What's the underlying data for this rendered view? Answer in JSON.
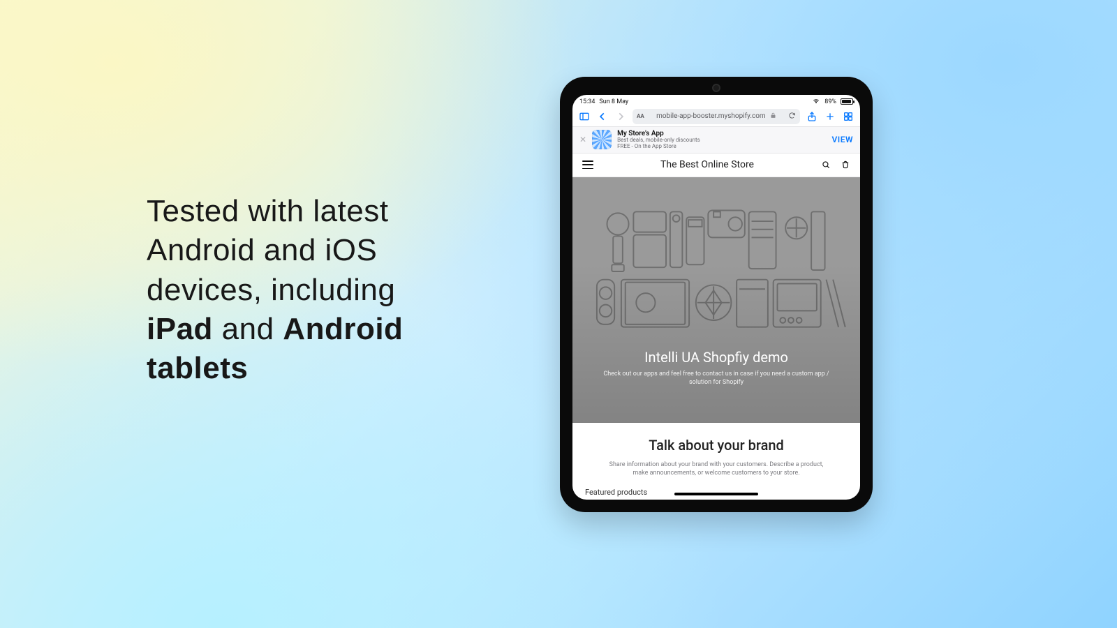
{
  "headline": {
    "line1": "Tested with latest",
    "line2": "Android and iOS",
    "line3": "devices, including",
    "bold1": "iPad",
    "mid": " and ",
    "bold2": "Android",
    "line5": "tablets"
  },
  "status": {
    "time": "15:34",
    "date": "Sun 8 May",
    "battery_pct": "89%"
  },
  "safari": {
    "aa": "AA",
    "url": "mobile-app-booster.myshopify.com"
  },
  "banner": {
    "title": "My Store's App",
    "sub1": "Best deals, mobile-only discounts",
    "sub2": "FREE - On the App Store",
    "view": "VIEW"
  },
  "store": {
    "title": "The Best Online Store"
  },
  "hero": {
    "title": "Intelli UA Shopfiy demo",
    "sub": "Check out our apps and feel free to contact us in case if you need a custom app / solution for Shopify"
  },
  "brand": {
    "title": "Talk about your brand",
    "sub": "Share information about your brand with your customers. Describe a product, make announcements, or welcome customers to your store."
  },
  "featured": {
    "heading": "Featured products"
  }
}
